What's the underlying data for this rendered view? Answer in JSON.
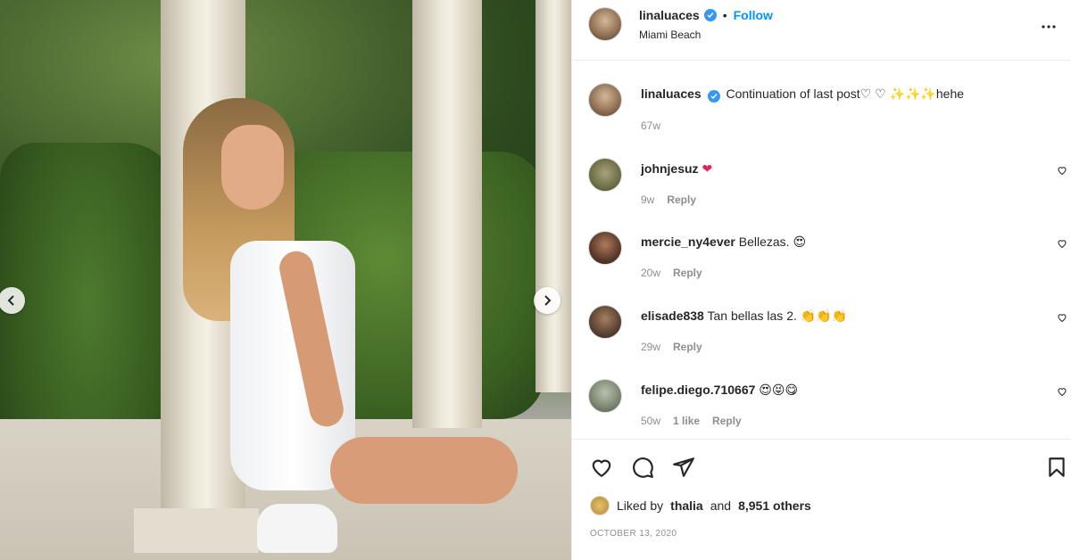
{
  "post": {
    "author": "linaluaces",
    "follow_label": "Follow",
    "dot": "•",
    "location": "Miami Beach",
    "more_label": "•••",
    "caption": {
      "username": "linaluaces",
      "text": "Continuation of last post♡ ♡ ✨✨✨hehe",
      "age": "67w"
    },
    "comments": [
      {
        "username": "johnjesuz",
        "text": "❤",
        "age": "9w",
        "likes": "",
        "reply": "Reply"
      },
      {
        "username": "mercie_ny4ever",
        "text": "Bellezas. 😍",
        "age": "20w",
        "likes": "",
        "reply": "Reply"
      },
      {
        "username": "elisade838",
        "text": "Tan bellas las 2. 👏👏👏",
        "age": "29w",
        "likes": "",
        "reply": "Reply"
      },
      {
        "username": "felipe.diego.710667",
        "text": "😍😝😋",
        "age": "50w",
        "likes": "1 like",
        "reply": "Reply"
      }
    ],
    "liked_by_prefix": "Liked by",
    "liked_by_user": "thalia",
    "liked_by_and": "and",
    "liked_by_others": "8,951 others",
    "date": "OCTOBER 13, 2020"
  },
  "colors": {
    "link_blue": "#0095f6",
    "verified_blue": "#3897f0",
    "muted": "#8e8e8e",
    "text": "#262626"
  },
  "icons": {
    "verified": "verified-badge-icon",
    "like": "heart-icon",
    "comment": "comment-icon",
    "share": "share-icon",
    "save": "bookmark-icon",
    "more": "more-icon",
    "prev": "chevron-left-icon",
    "next": "chevron-right-icon"
  }
}
